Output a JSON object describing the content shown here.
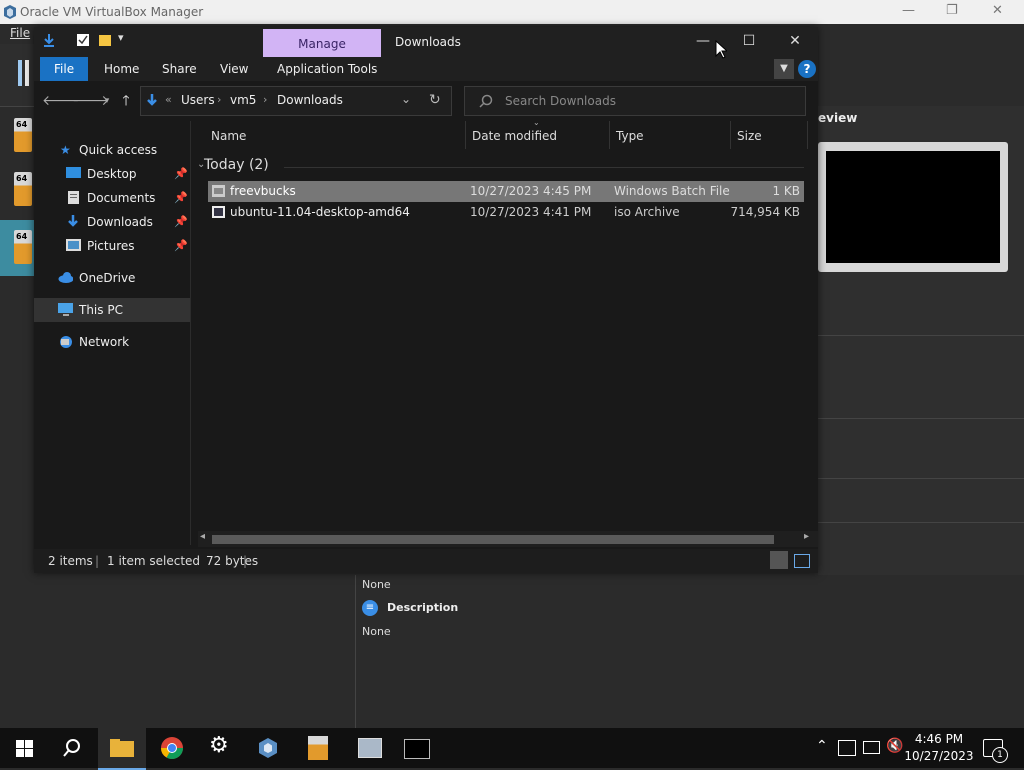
{
  "vbox": {
    "title": "Oracle VM VirtualBox Manager",
    "menu_file": "File",
    "vm_badge": "64",
    "preview_label": "eview",
    "storage_value": "None",
    "description_label": "Description",
    "description_value": "None",
    "minimize": "—",
    "maximize": "❐",
    "close": "✕"
  },
  "explorer": {
    "window_title": "Downloads",
    "manage_tab": "Manage",
    "minimize": "—",
    "maximize": "☐",
    "close": "✕",
    "ribbon_tabs": [
      "File",
      "Home",
      "Share",
      "View",
      "Application Tools"
    ],
    "help": "?",
    "address": {
      "overflow": "«",
      "segments": [
        "Users",
        "vm5",
        "Downloads"
      ]
    },
    "search_placeholder": "Search Downloads",
    "nav": {
      "quick_access": "Quick access",
      "desktop": "Desktop",
      "documents": "Documents",
      "downloads": "Downloads",
      "pictures": "Pictures",
      "onedrive": "OneDrive",
      "this_pc": "This PC",
      "network": "Network"
    },
    "columns": [
      "Name",
      "Date modified",
      "Type",
      "Size"
    ],
    "group_label": "Today (2)",
    "files": [
      {
        "name": "freevbucks",
        "date": "10/27/2023 4:45 PM",
        "type": "Windows Batch File",
        "size": "1 KB"
      },
      {
        "name": "ubuntu-11.04-desktop-amd64",
        "date": "10/27/2023 4:41 PM",
        "type": "iso Archive",
        "size": "714,954 KB"
      }
    ],
    "status": {
      "items": "2 items",
      "selected": "1 item selected",
      "bytes": "72 bytes"
    }
  },
  "taskbar": {
    "time": "4:46 PM",
    "date": "10/27/2023",
    "notification_count": "1"
  }
}
